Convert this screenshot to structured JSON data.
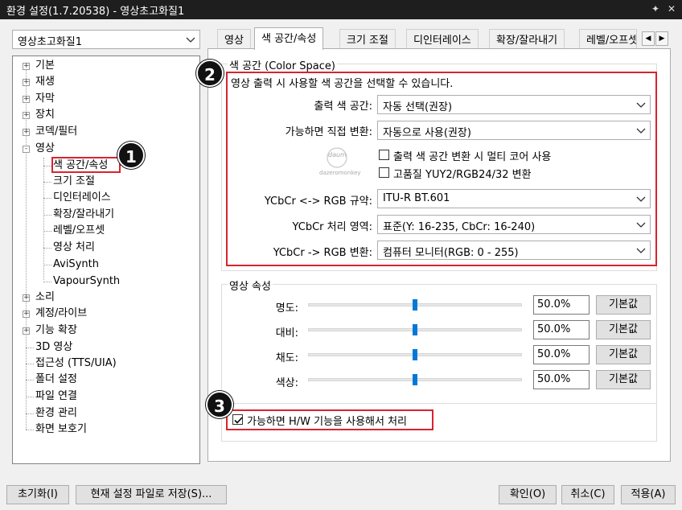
{
  "window": {
    "title": "환경 설정(1.7.20538) - 영상초고화질1",
    "pin_icon": "pin-icon",
    "close_icon": "close-icon"
  },
  "preset": {
    "value": "영상초고화질1"
  },
  "tree": {
    "items": [
      {
        "label": "기본",
        "expander": "+"
      },
      {
        "label": "재생",
        "expander": "+"
      },
      {
        "label": "자막",
        "expander": "+"
      },
      {
        "label": "장치",
        "expander": "+"
      },
      {
        "label": "코덱/필터",
        "expander": "+"
      },
      {
        "label": "영상",
        "expander": "-"
      },
      {
        "label": "색 공간/속성"
      },
      {
        "label": "크기 조절"
      },
      {
        "label": "디인터레이스"
      },
      {
        "label": "확장/잘라내기"
      },
      {
        "label": "레벨/오프셋"
      },
      {
        "label": "영상 처리"
      },
      {
        "label": "AviSynth"
      },
      {
        "label": "VapourSynth"
      },
      {
        "label": "소리",
        "expander": "+"
      },
      {
        "label": "계정/라이브",
        "expander": "+"
      },
      {
        "label": "기능 확장",
        "expander": "+"
      },
      {
        "label": "3D 영상"
      },
      {
        "label": "접근성 (TTS/UIA)"
      },
      {
        "label": "폴더 설정"
      },
      {
        "label": "파일 연결"
      },
      {
        "label": "환경 관리"
      },
      {
        "label": "화면 보호기"
      }
    ]
  },
  "tabs": [
    {
      "label": "영상"
    },
    {
      "label": "색 공간/속성"
    },
    {
      "label": "크기 조절"
    },
    {
      "label": "디인터레이스"
    },
    {
      "label": "확장/잘라내기"
    },
    {
      "label": "레벨/오프셋"
    }
  ],
  "tab_scroll": {
    "left": "◀",
    "right": "▶"
  },
  "color_space": {
    "group_title": "색 공간 (Color Space)",
    "description": "영상 출력 시 사용할 색 공간을 선택할 수 있습니다.",
    "output_label": "출력 색 공간:",
    "output_value": "자동 선택(권장)",
    "direct_label": "가능하면 직접 변환:",
    "direct_value": "자동으로 사용(권장)",
    "multicore_label": "출력 색 공간 변환 시 멀티 코어 사용",
    "multicore_checked": false,
    "hq_label": "고품질 YUY2/RGB24/32 변환",
    "hq_checked": false,
    "logo_text": "daum",
    "logo_caption": "dazeromonkey",
    "spec_label": "YCbCr <-> RGB 규약:",
    "spec_value": "ITU-R BT.601",
    "range_label": "YCbCr 처리 영역:",
    "range_value": "표준(Y: 16-235, CbCr: 16-240)",
    "convert_label": "YCbCr -> RGB 변환:",
    "convert_value": "컴퓨터 모니터(RGB: 0 - 255)"
  },
  "video_props": {
    "group_title": "영상 속성",
    "rows": [
      {
        "label": "명도:",
        "value": "50.0%",
        "level": 0.5,
        "reset": "기본값"
      },
      {
        "label": "대비:",
        "value": "50.0%",
        "level": 0.5,
        "reset": "기본값"
      },
      {
        "label": "채도:",
        "value": "50.0%",
        "level": 0.5,
        "reset": "기본값"
      },
      {
        "label": "색상:",
        "value": "50.0%",
        "level": 0.5,
        "reset": "기본값"
      }
    ]
  },
  "hw": {
    "label": "가능하면 H/W 기능을 사용해서 처리",
    "checked": true
  },
  "badges": [
    "1",
    "2",
    "3"
  ],
  "footer": {
    "reset": "초기화(I)",
    "save": "현재 설정 파일로 저장(S)...",
    "ok": "확인(O)",
    "cancel": "취소(C)",
    "apply": "적용(A)"
  },
  "colors": {
    "highlight": "#d9232e",
    "accent": "#0078d7",
    "titlebar": "#1e1e1e"
  }
}
